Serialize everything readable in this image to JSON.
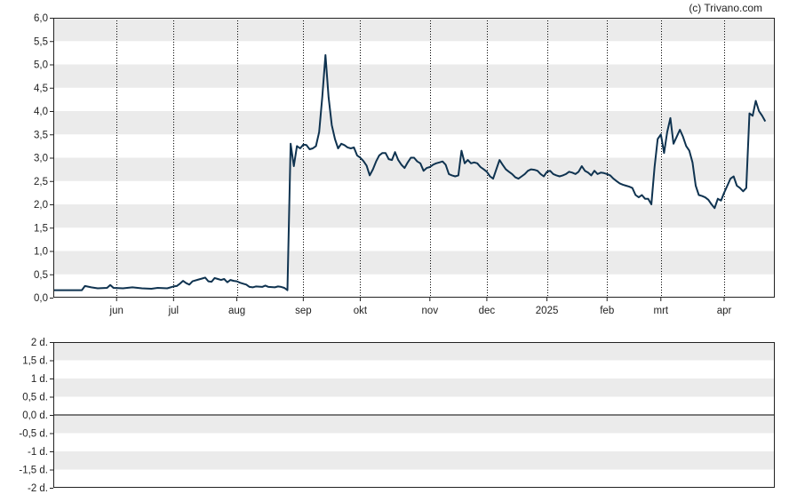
{
  "credit": "(c) Trivano.com",
  "colors": {
    "line": "#0f3350",
    "band": "#ebebeb",
    "grid": "#000000",
    "axis": "#222222"
  },
  "chart_data": [
    {
      "type": "line",
      "ylim": [
        0,
        6
      ],
      "yticks": [
        0,
        0.5,
        1,
        1.5,
        2,
        2.5,
        3,
        3.5,
        4,
        4.5,
        5,
        5.5,
        6
      ],
      "ytick_labels": [
        "0,0",
        "0,5",
        "1,0",
        "1,5",
        "2,0",
        "2,5",
        "3,0",
        "3,5",
        "4,0",
        "4,5",
        "5,0",
        "5,5",
        "6,0"
      ],
      "xlim": [
        0,
        228
      ],
      "x_axis_kind": "trading days",
      "xticks": [
        {
          "label": "jun",
          "x": 20
        },
        {
          "label": "jul",
          "x": 38
        },
        {
          "label": "aug",
          "x": 58
        },
        {
          "label": "sep",
          "x": 79
        },
        {
          "label": "okt",
          "x": 97
        },
        {
          "label": "nov",
          "x": 119
        },
        {
          "label": "dec",
          "x": 137
        },
        {
          "label": "2025",
          "x": 156
        },
        {
          "label": "feb",
          "x": 175
        },
        {
          "label": "mrt",
          "x": 192
        },
        {
          "label": "apr",
          "x": 212
        }
      ],
      "grid": "vertical dotted at month starts, alternating horizontal bands",
      "series": [
        {
          "points": [
            [
              0,
              0.16
            ],
            [
              3,
              0.16
            ],
            [
              6,
              0.16
            ],
            [
              9,
              0.16
            ],
            [
              10,
              0.25
            ],
            [
              12,
              0.22
            ],
            [
              14,
              0.2
            ],
            [
              17,
              0.21
            ],
            [
              18,
              0.27
            ],
            [
              19,
              0.21
            ],
            [
              22,
              0.2
            ],
            [
              25,
              0.22
            ],
            [
              28,
              0.2
            ],
            [
              31,
              0.19
            ],
            [
              33,
              0.21
            ],
            [
              36,
              0.2
            ],
            [
              38,
              0.24
            ],
            [
              39,
              0.25
            ],
            [
              40,
              0.3
            ],
            [
              41,
              0.36
            ],
            [
              42,
              0.31
            ],
            [
              43,
              0.28
            ],
            [
              44,
              0.35
            ],
            [
              46,
              0.39
            ],
            [
              47,
              0.41
            ],
            [
              48,
              0.43
            ],
            [
              49,
              0.35
            ],
            [
              50,
              0.34
            ],
            [
              51,
              0.42
            ],
            [
              52,
              0.4
            ],
            [
              53,
              0.38
            ],
            [
              54,
              0.4
            ],
            [
              55,
              0.33
            ],
            [
              56,
              0.38
            ],
            [
              57,
              0.36
            ],
            [
              58,
              0.35
            ],
            [
              59,
              0.32
            ],
            [
              60,
              0.3
            ],
            [
              61,
              0.28
            ],
            [
              62,
              0.23
            ],
            [
              63,
              0.22
            ],
            [
              64,
              0.24
            ],
            [
              66,
              0.23
            ],
            [
              67,
              0.26
            ],
            [
              68,
              0.23
            ],
            [
              70,
              0.22
            ],
            [
              71,
              0.24
            ],
            [
              72,
              0.23
            ],
            [
              73,
              0.21
            ],
            [
              74,
              0.16
            ],
            [
              75,
              3.3
            ],
            [
              76,
              2.82
            ],
            [
              77,
              3.25
            ],
            [
              78,
              3.2
            ],
            [
              79,
              3.28
            ],
            [
              80,
              3.27
            ],
            [
              81,
              3.18
            ],
            [
              82,
              3.2
            ],
            [
              83,
              3.25
            ],
            [
              84,
              3.55
            ],
            [
              85,
              4.3
            ],
            [
              86,
              5.2
            ],
            [
              87,
              4.3
            ],
            [
              88,
              3.7
            ],
            [
              89,
              3.4
            ],
            [
              90,
              3.2
            ],
            [
              91,
              3.3
            ],
            [
              92,
              3.27
            ],
            [
              93,
              3.22
            ],
            [
              94,
              3.2
            ],
            [
              95,
              3.22
            ],
            [
              96,
              3.05
            ],
            [
              97,
              3.0
            ],
            [
              98,
              2.93
            ],
            [
              99,
              2.83
            ],
            [
              100,
              2.62
            ],
            [
              101,
              2.75
            ],
            [
              102,
              2.92
            ],
            [
              103,
              3.05
            ],
            [
              104,
              3.1
            ],
            [
              105,
              3.1
            ],
            [
              106,
              2.97
            ],
            [
              107,
              2.95
            ],
            [
              108,
              3.12
            ],
            [
              109,
              2.95
            ],
            [
              110,
              2.85
            ],
            [
              111,
              2.78
            ],
            [
              112,
              2.9
            ],
            [
              113,
              3.0
            ],
            [
              114,
              3.0
            ],
            [
              115,
              2.92
            ],
            [
              116,
              2.88
            ],
            [
              117,
              2.72
            ],
            [
              118,
              2.78
            ],
            [
              119,
              2.8
            ],
            [
              120,
              2.85
            ],
            [
              121,
              2.88
            ],
            [
              122,
              2.9
            ],
            [
              123,
              2.92
            ],
            [
              124,
              2.85
            ],
            [
              125,
              2.65
            ],
            [
              126,
              2.62
            ],
            [
              127,
              2.6
            ],
            [
              128,
              2.62
            ],
            [
              129,
              3.15
            ],
            [
              130,
              2.88
            ],
            [
              131,
              2.95
            ],
            [
              132,
              2.88
            ],
            [
              133,
              2.9
            ],
            [
              134,
              2.88
            ],
            [
              135,
              2.8
            ],
            [
              136,
              2.75
            ],
            [
              137,
              2.7
            ],
            [
              138,
              2.6
            ],
            [
              139,
              2.55
            ],
            [
              140,
              2.75
            ],
            [
              141,
              2.95
            ],
            [
              142,
              2.85
            ],
            [
              143,
              2.75
            ],
            [
              144,
              2.7
            ],
            [
              145,
              2.65
            ],
            [
              146,
              2.58
            ],
            [
              147,
              2.55
            ],
            [
              148,
              2.6
            ],
            [
              149,
              2.65
            ],
            [
              150,
              2.72
            ],
            [
              151,
              2.75
            ],
            [
              152,
              2.74
            ],
            [
              153,
              2.72
            ],
            [
              154,
              2.65
            ],
            [
              155,
              2.6
            ],
            [
              156,
              2.7
            ],
            [
              157,
              2.72
            ],
            [
              158,
              2.65
            ],
            [
              159,
              2.62
            ],
            [
              160,
              2.6
            ],
            [
              161,
              2.62
            ],
            [
              162,
              2.65
            ],
            [
              163,
              2.7
            ],
            [
              164,
              2.68
            ],
            [
              165,
              2.65
            ],
            [
              166,
              2.7
            ],
            [
              167,
              2.82
            ],
            [
              168,
              2.72
            ],
            [
              169,
              2.68
            ],
            [
              170,
              2.62
            ],
            [
              171,
              2.72
            ],
            [
              172,
              2.65
            ],
            [
              173,
              2.68
            ],
            [
              174,
              2.67
            ],
            [
              175,
              2.65
            ],
            [
              176,
              2.62
            ],
            [
              177,
              2.55
            ],
            [
              178,
              2.5
            ],
            [
              179,
              2.45
            ],
            [
              180,
              2.42
            ],
            [
              181,
              2.4
            ],
            [
              182,
              2.38
            ],
            [
              183,
              2.35
            ],
            [
              184,
              2.2
            ],
            [
              185,
              2.15
            ],
            [
              186,
              2.2
            ],
            [
              187,
              2.12
            ],
            [
              188,
              2.12
            ],
            [
              189,
              2.0
            ],
            [
              190,
              2.8
            ],
            [
              191,
              3.4
            ],
            [
              192,
              3.5
            ],
            [
              193,
              3.1
            ],
            [
              194,
              3.55
            ],
            [
              195,
              3.85
            ],
            [
              196,
              3.3
            ],
            [
              197,
              3.45
            ],
            [
              198,
              3.6
            ],
            [
              199,
              3.45
            ],
            [
              200,
              3.25
            ],
            [
              201,
              3.15
            ],
            [
              202,
              2.9
            ],
            [
              203,
              2.4
            ],
            [
              204,
              2.2
            ],
            [
              205,
              2.18
            ],
            [
              206,
              2.15
            ],
            [
              207,
              2.1
            ],
            [
              208,
              2.0
            ],
            [
              209,
              1.92
            ],
            [
              210,
              2.12
            ],
            [
              211,
              2.08
            ],
            [
              212,
              2.25
            ],
            [
              213,
              2.4
            ],
            [
              214,
              2.55
            ],
            [
              215,
              2.6
            ],
            [
              216,
              2.4
            ],
            [
              217,
              2.35
            ],
            [
              218,
              2.28
            ],
            [
              219,
              2.35
            ],
            [
              220,
              3.95
            ],
            [
              221,
              3.9
            ],
            [
              222,
              4.22
            ],
            [
              223,
              4.0
            ],
            [
              224,
              3.9
            ],
            [
              225,
              3.78
            ]
          ]
        }
      ]
    },
    {
      "type": "line",
      "ylim": [
        -2,
        2
      ],
      "yticks": [
        -2,
        -1.5,
        -1,
        -0.5,
        0,
        0.5,
        1,
        1.5,
        2
      ],
      "ytick_labels": [
        "-2 d.",
        "-1,5 d.",
        "-1 d.",
        "-0,5 d.",
        "0,0 d.",
        "0,5 d.",
        "1 d.",
        "1,5 d.",
        "2 d."
      ],
      "series": [
        {
          "points": [
            [
              0,
              0
            ],
            [
              228,
              0
            ]
          ]
        }
      ]
    }
  ]
}
